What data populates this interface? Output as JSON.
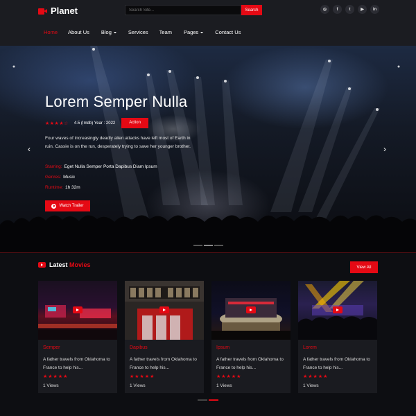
{
  "brand": {
    "name": "Planet"
  },
  "search": {
    "placeholder": "Search Site...",
    "button": "Search"
  },
  "socials": [
    {
      "icon": "instagram-icon",
      "glyph": "◎"
    },
    {
      "icon": "facebook-icon",
      "glyph": "f"
    },
    {
      "icon": "twitter-icon",
      "glyph": "t"
    },
    {
      "icon": "youtube-icon",
      "glyph": "▶"
    },
    {
      "icon": "linkedin-icon",
      "glyph": "in"
    }
  ],
  "nav": [
    {
      "label": "Home",
      "active": true,
      "dropdown": false
    },
    {
      "label": "About Us",
      "active": false,
      "dropdown": false
    },
    {
      "label": "Blog",
      "active": false,
      "dropdown": true
    },
    {
      "label": "Services",
      "active": false,
      "dropdown": false
    },
    {
      "label": "Team",
      "active": false,
      "dropdown": false
    },
    {
      "label": "Pages",
      "active": false,
      "dropdown": true
    },
    {
      "label": "Contact Us",
      "active": false,
      "dropdown": false
    }
  ],
  "hero": {
    "title": "Lorem Semper Nulla",
    "stars": "★★★★☆",
    "rating_text": "4.5 (Imdb) Year : 2022",
    "badge": "Action",
    "description": "Four waves of increasingly deadly alien attacks have left most of Earth in ruin. Cassie is on the run, desperately trying to save her younger brother.",
    "starring_label": "Starring:",
    "starring": "Eget Nulla Semper Porta Dapibus Diam Ipsum",
    "genres_label": "Genres:",
    "genres": "Music",
    "runtime_label": "Runtime:",
    "runtime": "1h 32m",
    "button": "Watch Trailer",
    "prev_arrow": "‹",
    "next_arrow": "›"
  },
  "latest": {
    "title_white": "Latest",
    "title_red": "Movies",
    "view_all": "View All",
    "cards": [
      {
        "genre": "Semper",
        "description": "A father travels from Oklahoma to France to help his...",
        "stars": "★★★★★",
        "views": "1 Views"
      },
      {
        "genre": "Dapibus",
        "description": "A father travels from Oklahoma to France to help his...",
        "stars": "★★★★★",
        "views": "1 Views"
      },
      {
        "genre": "Ipsum",
        "description": "A father travels from Oklahoma to France to help his...",
        "stars": "★★★★★",
        "views": "1 Views"
      },
      {
        "genre": "Lorem",
        "description": "A father travels from Oklahoma to France to help his...",
        "stars": "★★★★★",
        "views": "1 Views"
      }
    ]
  },
  "colors": {
    "accent": "#e50914",
    "header": "#1b1c21",
    "background": "#0d0e12",
    "card": "#1a1b20"
  }
}
